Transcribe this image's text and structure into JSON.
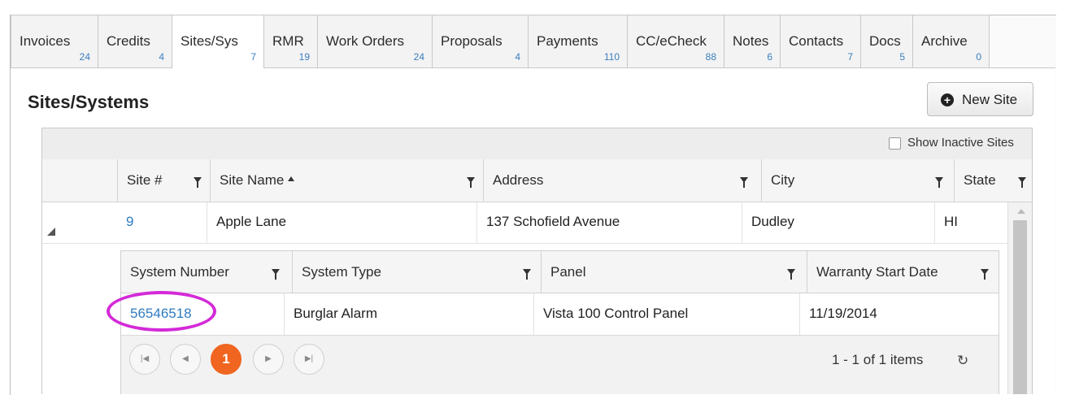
{
  "tabs": [
    {
      "label": "Invoices",
      "count": "24"
    },
    {
      "label": "Credits",
      "count": "4"
    },
    {
      "label": "Sites/Sys",
      "count": "7"
    },
    {
      "label": "RMR",
      "count": "19"
    },
    {
      "label": "Work Orders",
      "count": "24"
    },
    {
      "label": "Proposals",
      "count": "4"
    },
    {
      "label": "Payments",
      "count": "110"
    },
    {
      "label": "CC/eCheck",
      "count": "88"
    },
    {
      "label": "Notes",
      "count": "6"
    },
    {
      "label": "Contacts",
      "count": "7"
    },
    {
      "label": "Docs",
      "count": "5"
    },
    {
      "label": "Archive",
      "count": "0"
    }
  ],
  "active_tab": "Sites/Sys",
  "page_title": "Sites/Systems",
  "new_site_button": {
    "label": "New Site",
    "icon": "plus-circle-icon"
  },
  "toolbar": {
    "show_inactive_label": "Show Inactive Sites",
    "show_inactive_checked": false
  },
  "sites_table": {
    "columns": [
      "Site #",
      "Site Name",
      "Address",
      "City",
      "State"
    ],
    "sorted_column": "Site Name",
    "rows": [
      {
        "site_no": "9",
        "site_name": "Apple Lane",
        "address": "137 Schofield Avenue",
        "city": "Dudley",
        "state": "HI",
        "expanded": true
      }
    ]
  },
  "systems_table": {
    "columns": [
      "System Number",
      "System Type",
      "Panel",
      "Warranty Start Date"
    ],
    "rows": [
      {
        "system_number": "56546518",
        "system_type": "Burglar Alarm",
        "panel": "Vista 100 Control Panel",
        "warranty_start": "11/19/2014"
      }
    ]
  },
  "pager": {
    "current_page": "1",
    "info": "1 - 1 of 1 items"
  },
  "colors": {
    "accent": "#f0651f",
    "link": "#2f7cc2",
    "highlight": "#d42ad8"
  }
}
